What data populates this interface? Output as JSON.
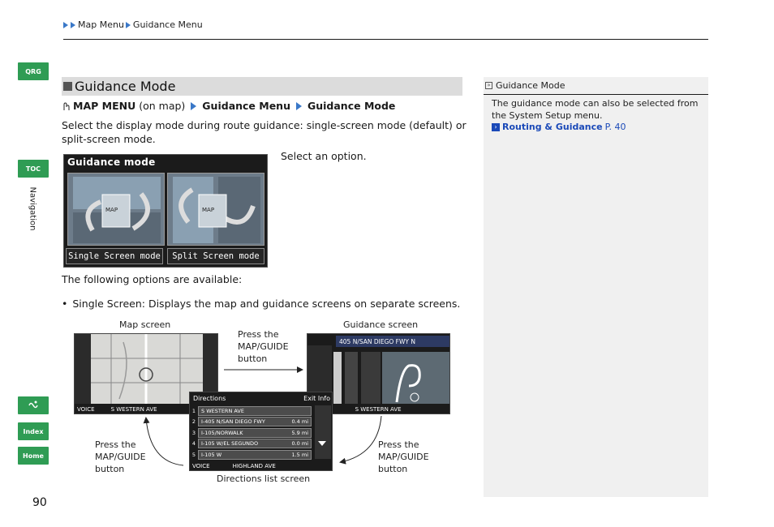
{
  "breadcrumb": {
    "items": [
      "Map Menu",
      "Guidance Menu"
    ]
  },
  "sidetabs": {
    "qrg": "QRG",
    "toc": "TOC",
    "index": "Index",
    "home": "Home",
    "navigation_label": "Navigation"
  },
  "section": {
    "title": "Guidance Mode",
    "path": {
      "step1": "MAP MENU",
      "step1_note": "(on map)",
      "step2": "Guidance Menu",
      "step3": "Guidance Mode"
    },
    "description": "Select the display mode during route guidance: single-screen mode (default) or split-screen mode.",
    "select_caption": "Select an option.",
    "following": "The following options are available:",
    "bullet_term": "Single Screen:",
    "bullet_text": "Displays the map and guidance screens on separate screens."
  },
  "guidance_screen": {
    "title": "Guidance mode",
    "button_single": "Single Screen mode",
    "button_split": "Split Screen mode",
    "map_label_left": "MAP",
    "map_label_right": "MAP"
  },
  "diagram": {
    "map_screen_label": "Map screen",
    "guidance_screen_label": "Guidance screen",
    "press_top": "Press the MAP/GUIDE button",
    "press_left": "Press the MAP/GUIDE button",
    "press_right": "Press the MAP/GUIDE button",
    "directions_list_label": "Directions list screen",
    "map_street": "S WESTERN AVE",
    "guide_street": "S WESTERN AVE",
    "guide_header": "405 N/SAN DIEGO FWY N",
    "voice": "VOICE",
    "directions_title": "Directions",
    "directions_exit": "Exit Info",
    "directions_footer": "HIGHLAND AVE",
    "directions_rows": [
      {
        "num": "1",
        "text": "S WESTERN AVE",
        "dist": ""
      },
      {
        "num": "2",
        "text": "I-405 N/SAN DIEGO FWY",
        "dist": "0.4 mi"
      },
      {
        "num": "3",
        "text": "I-105/NORWALK",
        "dist": "5.9 mi"
      },
      {
        "num": "4",
        "text": "I-105 W/EL SEGUNDO",
        "dist": "0.0 mi"
      },
      {
        "num": "5",
        "text": "I-105 W",
        "dist": "1.5 mi"
      }
    ]
  },
  "note": {
    "heading": "Guidance Mode",
    "text": "The guidance mode can also be selected from the System Setup menu.",
    "link_label": "Routing & Guidance",
    "link_page": "P. 40"
  },
  "page_number": "90"
}
